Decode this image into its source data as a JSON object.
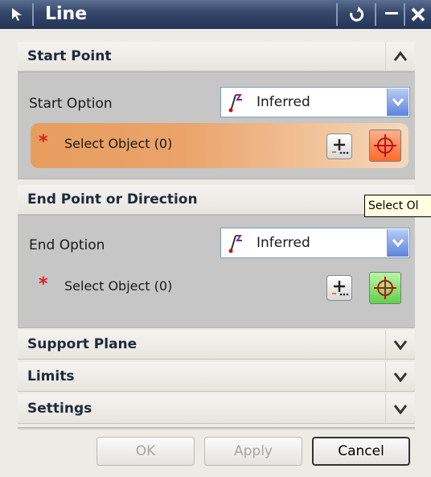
{
  "window": {
    "title": "Line",
    "controls": [
      "reset",
      "minimize",
      "close"
    ]
  },
  "sections": {
    "start_point": {
      "title": "Start Point",
      "expanded": true,
      "option_label": "Start Option",
      "option_value": "Inferred",
      "select_label": "Select Object (0)"
    },
    "end_point": {
      "title": "End Point or Direction",
      "expanded": true,
      "option_label": "End Option",
      "option_value": "Inferred",
      "select_label": "Select Object (0)"
    },
    "support_plane": {
      "title": "Support Plane",
      "expanded": false
    },
    "limits": {
      "title": "Limits",
      "expanded": false
    },
    "settings": {
      "title": "Settings",
      "expanded": false
    }
  },
  "tooltip": {
    "text": "Select Ol"
  },
  "buttons": {
    "ok": "OK",
    "apply": "Apply",
    "cancel": "Cancel"
  },
  "colors": {
    "title_bar": "#34466a",
    "active_row": "#e79d5e",
    "required_star": "#e21d1d",
    "crosshair_active": "#ff6a2a",
    "crosshair_green": "#5fd24a"
  }
}
